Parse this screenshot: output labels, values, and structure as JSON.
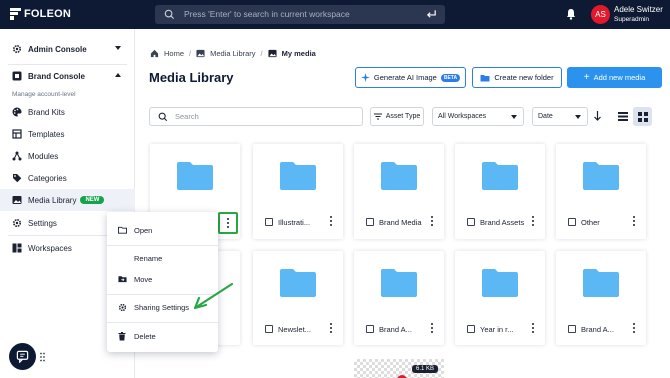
{
  "topbar": {
    "brand": "FOLEON",
    "search_placeholder": "Press 'Enter' to search in current workspace",
    "user_initials": "AS",
    "user_name": "Adele Switzer",
    "user_role": "Superadmin"
  },
  "sidebar": {
    "admin_console": "Admin Console",
    "brand_console": "Brand Console",
    "manage_level": "Manage account-level",
    "items": [
      {
        "label": "Brand Kits",
        "icon": "palette-icon"
      },
      {
        "label": "Templates",
        "icon": "template-icon"
      },
      {
        "label": "Modules",
        "icon": "modules-icon"
      },
      {
        "label": "Categories",
        "icon": "tag-icon"
      },
      {
        "label": "Media Library",
        "icon": "image-icon"
      },
      {
        "label": "Settings",
        "icon": "gear-icon"
      }
    ],
    "new_badge": "NEW",
    "workspaces": "Workspaces"
  },
  "breadcrumb": {
    "home": "Home",
    "media_library": "Media Library",
    "current": "My media"
  },
  "page_title": "Media Library",
  "actions": {
    "generate_ai": "Generate AI Image",
    "beta": "BETA",
    "new_folder": "Create new folder",
    "add_media": "Add new media"
  },
  "filters": {
    "search_placeholder": "Search",
    "asset_type": "Asset Type",
    "workspaces": "All Workspaces",
    "sort": "Date"
  },
  "folders_row1": [
    "",
    "Illustrati...",
    "Brand Media",
    "Brand Assets",
    "Other"
  ],
  "folders_row2": [
    "",
    "Newslet...",
    "Brand A...",
    "Year in r...",
    "Brand A..."
  ],
  "file_size": "6.1 KB",
  "context_menu": {
    "open": "Open",
    "rename": "Rename",
    "move": "Move",
    "sharing": "Sharing Settings",
    "delete": "Delete"
  },
  "colors": {
    "topbar": "#0e1a33",
    "folder": "#5bb8f5",
    "primary": "#2b93ee",
    "highlight": "#28a745"
  }
}
